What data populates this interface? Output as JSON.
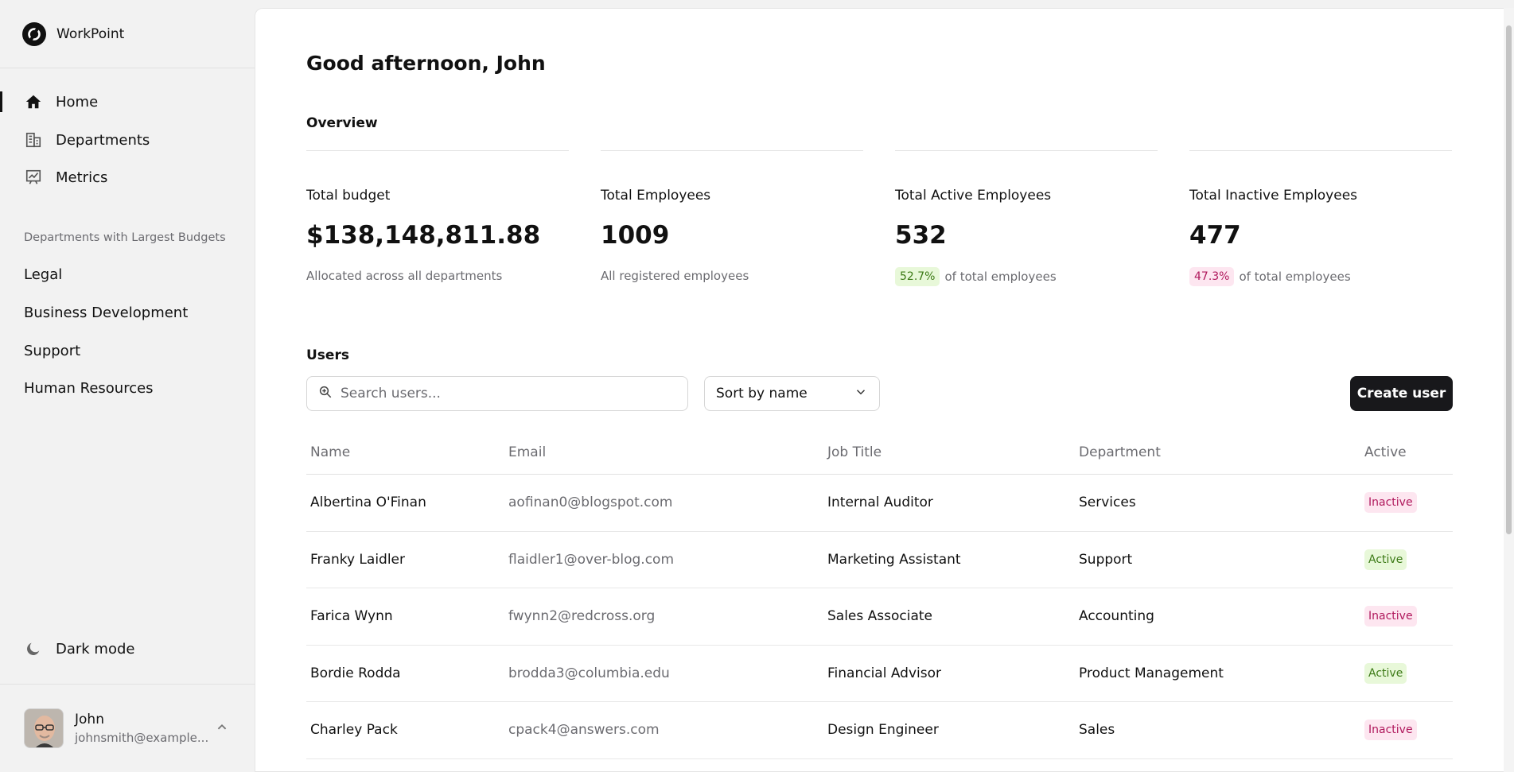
{
  "app": {
    "name": "WorkPoint"
  },
  "sidebar": {
    "nav": [
      {
        "label": "Home",
        "icon": "home-icon",
        "active": true
      },
      {
        "label": "Departments",
        "icon": "building-icon",
        "active": false
      },
      {
        "label": "Metrics",
        "icon": "chart-icon",
        "active": false
      }
    ],
    "section_label": "Departments with Largest Budgets",
    "departments": [
      "Legal",
      "Business Development",
      "Support",
      "Human Resources"
    ],
    "dark_mode_label": "Dark mode",
    "user": {
      "name": "John",
      "email": "johnsmith@example..."
    }
  },
  "main": {
    "greeting": "Good afternoon, John",
    "overview_title": "Overview",
    "stats": [
      {
        "label": "Total budget",
        "value": "$138,148,811.88",
        "sub": "Allocated across all departments",
        "badge": ""
      },
      {
        "label": "Total Employees",
        "value": "1009",
        "sub": "All registered employees",
        "badge": ""
      },
      {
        "label": "Total Active Employees",
        "value": "532",
        "sub": "of total employees",
        "badge": "52.7%"
      },
      {
        "label": "Total Inactive Employees",
        "value": "477",
        "sub": "of total employees",
        "badge": "47.3%"
      }
    ],
    "users_title": "Users",
    "search_placeholder": "Search users...",
    "sort_value": "Sort by name",
    "create_button": "Create user",
    "table": {
      "headers": [
        "Name",
        "Email",
        "Job Title",
        "Department",
        "Active"
      ],
      "rows": [
        {
          "name": "Albertina O'Finan",
          "email": "aofinan0@blogspot.com",
          "job": "Internal Auditor",
          "dept": "Services",
          "status": "Inactive"
        },
        {
          "name": "Franky Laidler",
          "email": "flaidler1@over-blog.com",
          "job": "Marketing Assistant",
          "dept": "Support",
          "status": "Active"
        },
        {
          "name": "Farica Wynn",
          "email": "fwynn2@redcross.org",
          "job": "Sales Associate",
          "dept": "Accounting",
          "status": "Inactive"
        },
        {
          "name": "Bordie Rodda",
          "email": "brodda3@columbia.edu",
          "job": "Financial Advisor",
          "dept": "Product Management",
          "status": "Active"
        },
        {
          "name": "Charley Pack",
          "email": "cpack4@answers.com",
          "job": "Design Engineer",
          "dept": "Sales",
          "status": "Inactive"
        }
      ]
    }
  },
  "colors": {
    "accent_dark": "#18181b",
    "active_bg": "#e8f8d9",
    "active_text": "#3c7a16",
    "inactive_bg": "#fde6f0",
    "inactive_text": "#b0185c"
  }
}
